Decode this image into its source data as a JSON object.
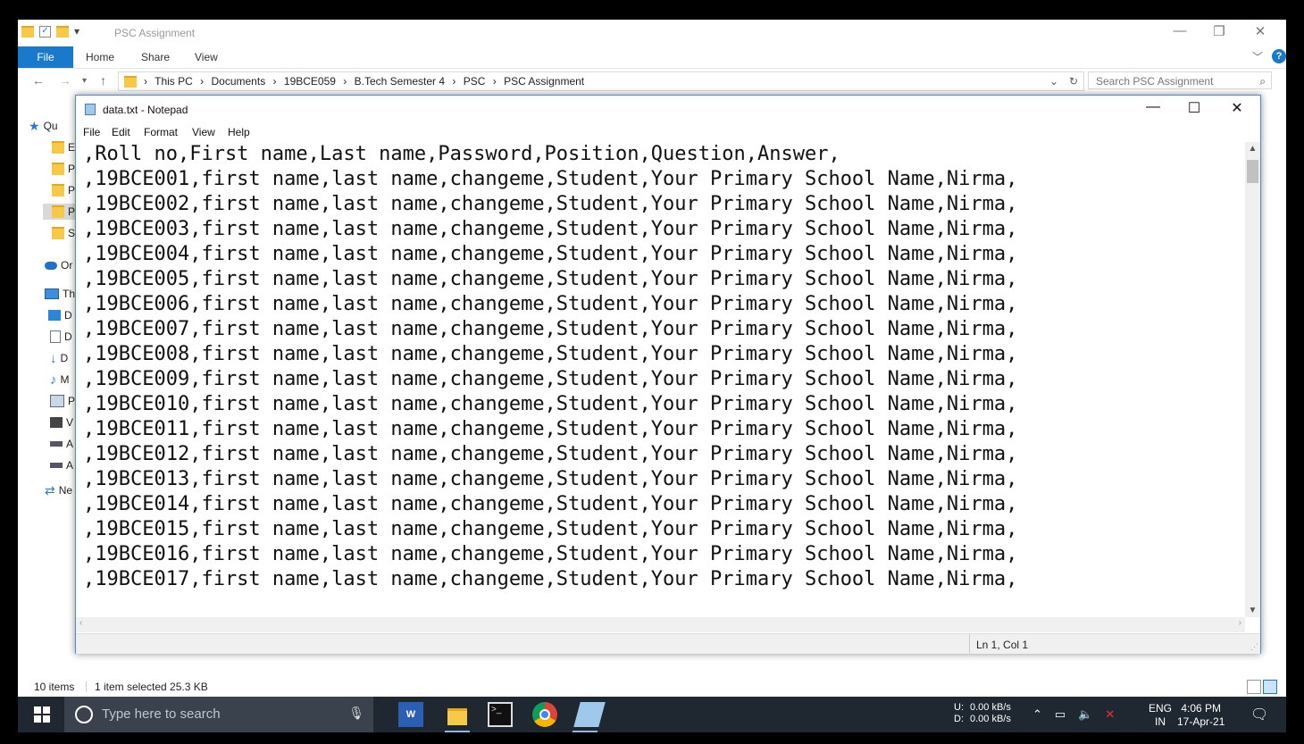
{
  "explorer": {
    "title": "PSC Assignment",
    "ribbon_tabs": [
      "File",
      "Home",
      "Share",
      "View"
    ],
    "breadcrumbs": [
      "This PC",
      "Documents",
      "19BCE059",
      "B.Tech Semester 4",
      "PSC",
      "PSC Assignment"
    ],
    "search_placeholder": "Search PSC Assignment",
    "nav_items": [
      {
        "icon": "star-icon",
        "label": "Qu"
      },
      {
        "icon": "folder-icon",
        "label": "E"
      },
      {
        "icon": "folder-icon",
        "label": "P"
      },
      {
        "icon": "folder-icon",
        "label": "P"
      },
      {
        "icon": "folder-icon",
        "label": "P"
      },
      {
        "icon": "folder-icon",
        "label": "S"
      },
      {
        "icon": "cloud-icon",
        "label": "Or"
      },
      {
        "icon": "pc-icon",
        "label": "Th"
      },
      {
        "icon": "desktop-icon",
        "label": "D"
      },
      {
        "icon": "document-icon",
        "label": "D"
      },
      {
        "icon": "download-icon",
        "label": "D"
      },
      {
        "icon": "music-icon",
        "label": "M"
      },
      {
        "icon": "picture-icon",
        "label": "P"
      },
      {
        "icon": "video-icon",
        "label": "V"
      },
      {
        "icon": "drive-icon",
        "label": "A"
      },
      {
        "icon": "drive-icon",
        "label": "A"
      },
      {
        "icon": "network-icon",
        "label": "Ne"
      }
    ],
    "status": {
      "items": "10 items",
      "selected": "1 item selected  25.3 KB"
    }
  },
  "notepad": {
    "title": "data.txt - Notepad",
    "menu": [
      "File",
      "Edit",
      "Format",
      "View",
      "Help"
    ],
    "lines": [
      ",Roll no,First name,Last name,Password,Position,Question,Answer,",
      ",19BCE001,first name,last name,changeme,Student,Your Primary School Name,Nirma,",
      ",19BCE002,first name,last name,changeme,Student,Your Primary School Name,Nirma,",
      ",19BCE003,first name,last name,changeme,Student,Your Primary School Name,Nirma,",
      ",19BCE004,first name,last name,changeme,Student,Your Primary School Name,Nirma,",
      ",19BCE005,first name,last name,changeme,Student,Your Primary School Name,Nirma,",
      ",19BCE006,first name,last name,changeme,Student,Your Primary School Name,Nirma,",
      ",19BCE007,first name,last name,changeme,Student,Your Primary School Name,Nirma,",
      ",19BCE008,first name,last name,changeme,Student,Your Primary School Name,Nirma,",
      ",19BCE009,first name,last name,changeme,Student,Your Primary School Name,Nirma,",
      ",19BCE010,first name,last name,changeme,Student,Your Primary School Name,Nirma,",
      ",19BCE011,first name,last name,changeme,Student,Your Primary School Name,Nirma,",
      ",19BCE012,first name,last name,changeme,Student,Your Primary School Name,Nirma,",
      ",19BCE013,first name,last name,changeme,Student,Your Primary School Name,Nirma,",
      ",19BCE014,first name,last name,changeme,Student,Your Primary School Name,Nirma,",
      ",19BCE015,first name,last name,changeme,Student,Your Primary School Name,Nirma,",
      ",19BCE016,first name,last name,changeme,Student,Your Primary School Name,Nirma,",
      ",19BCE017,first name,last name,changeme,Student,Your Primary School Name,Nirma,"
    ],
    "cursor_position": "Ln 1, Col 1"
  },
  "taskbar": {
    "search_placeholder": "Type here to search",
    "apps": [
      "word-icon",
      "file-explorer-icon",
      "terminal-icon",
      "chrome-icon",
      "notepad-icon"
    ],
    "network_upload_label": "U:",
    "network_upload": "0.00 kB/s",
    "network_download_label": "D:",
    "network_download": "0.00 kB/s",
    "language": "ENG",
    "region": "IN",
    "time": "4:06 PM",
    "date": "17-Apr-21"
  }
}
